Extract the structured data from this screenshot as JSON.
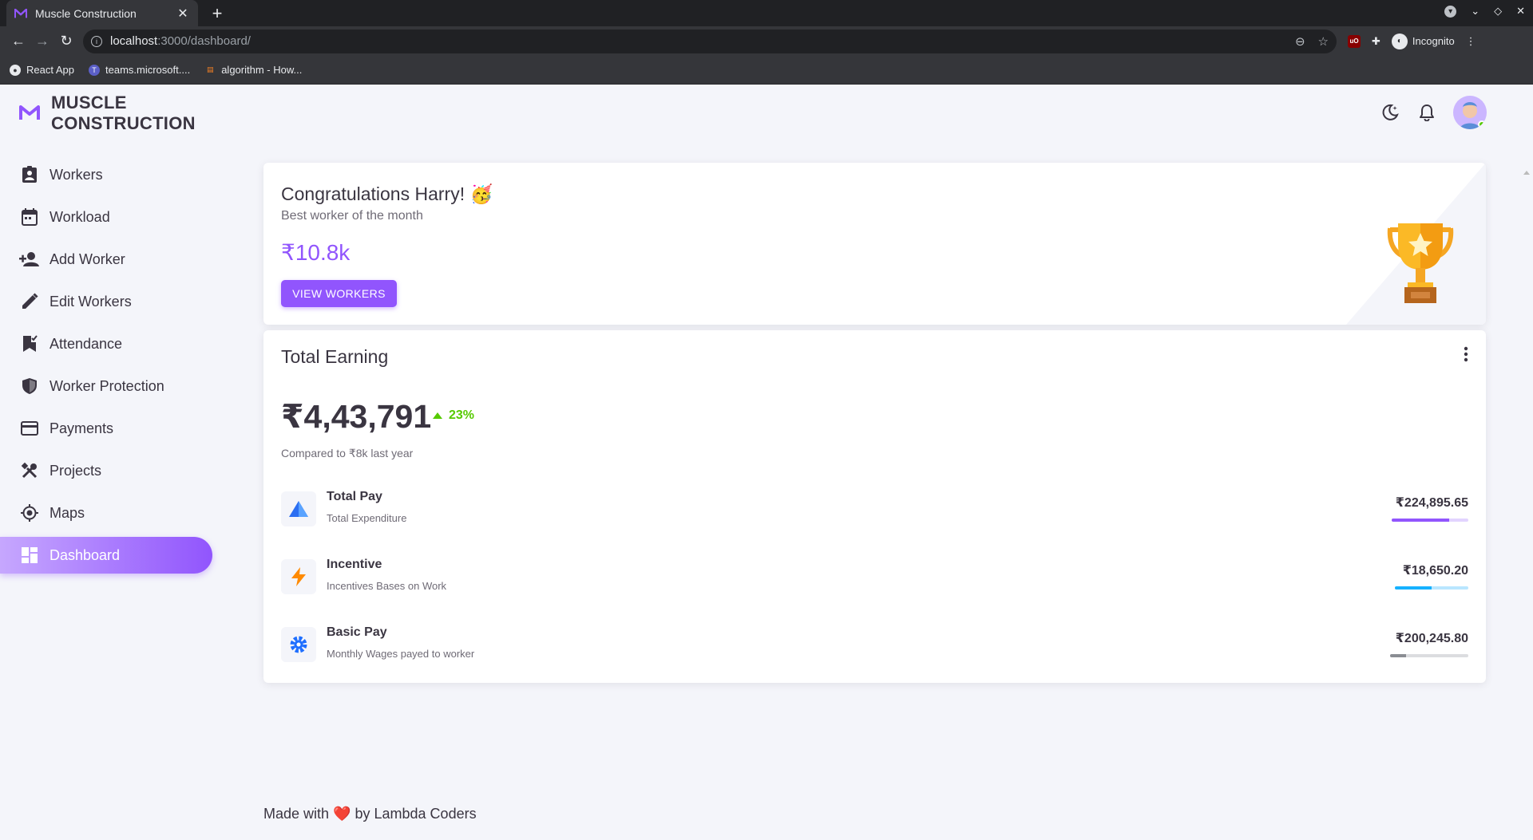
{
  "browser": {
    "tab_title": "Muscle Construction",
    "url_host": "localhost",
    "url_path": ":3000/dashboard/",
    "profile_label": "Incognito",
    "bookmarks": [
      {
        "label": "React App"
      },
      {
        "label": "teams.microsoft...."
      },
      {
        "label": "algorithm - How..."
      }
    ]
  },
  "brand": {
    "line1": "MUSCLE",
    "line2": "CONSTRUCTION"
  },
  "sidebar": {
    "items": [
      {
        "label": "Workers",
        "icon": "badge-icon"
      },
      {
        "label": "Workload",
        "icon": "calendar-icon"
      },
      {
        "label": "Add Worker",
        "icon": "person-add-icon"
      },
      {
        "label": "Edit Workers",
        "icon": "pencil-icon"
      },
      {
        "label": "Attendance",
        "icon": "bookmark-check-icon"
      },
      {
        "label": "Worker Protection",
        "icon": "shield-icon"
      },
      {
        "label": "Payments",
        "icon": "credit-card-icon"
      },
      {
        "label": "Projects",
        "icon": "tools-icon"
      },
      {
        "label": "Maps",
        "icon": "crosshair-icon"
      },
      {
        "label": "Dashboard",
        "icon": "dashboard-icon",
        "active": true
      }
    ]
  },
  "congrats": {
    "title": "Congratulations Harry! 🥳",
    "subtitle": "Best worker of the month",
    "amount": "₹10.8k",
    "button": "VIEW WORKERS"
  },
  "earning": {
    "title": "Total Earning",
    "total": "₹4,43,791",
    "delta": "23%",
    "compare": "Compared to ₹8k last year",
    "rows": [
      {
        "name": "Total Pay",
        "sub": "Total Expenditure",
        "value": "₹224,895.65",
        "progress": 0.75,
        "color": "#9155fd",
        "track": "#e2d4ff",
        "icon": "triangle-icon"
      },
      {
        "name": "Incentive",
        "sub": "Incentives Bases on Work",
        "value": "₹18,650.20",
        "progress": 0.5,
        "color": "#16b1ff",
        "track": "#b9e6ff",
        "icon": "lightning-icon"
      },
      {
        "name": "Basic Pay",
        "sub": "Monthly Wages payed to worker",
        "value": "₹200,245.80",
        "progress": 0.2,
        "color": "#8a8d93",
        "track": "#dcdde0",
        "icon": "gear-icon"
      }
    ]
  },
  "footer": {
    "prefix": "Made with",
    "heart": "❤️",
    "suffix": "by Lambda Coders"
  },
  "colors": {
    "primary": "#9155fd",
    "success": "#56ca00"
  }
}
